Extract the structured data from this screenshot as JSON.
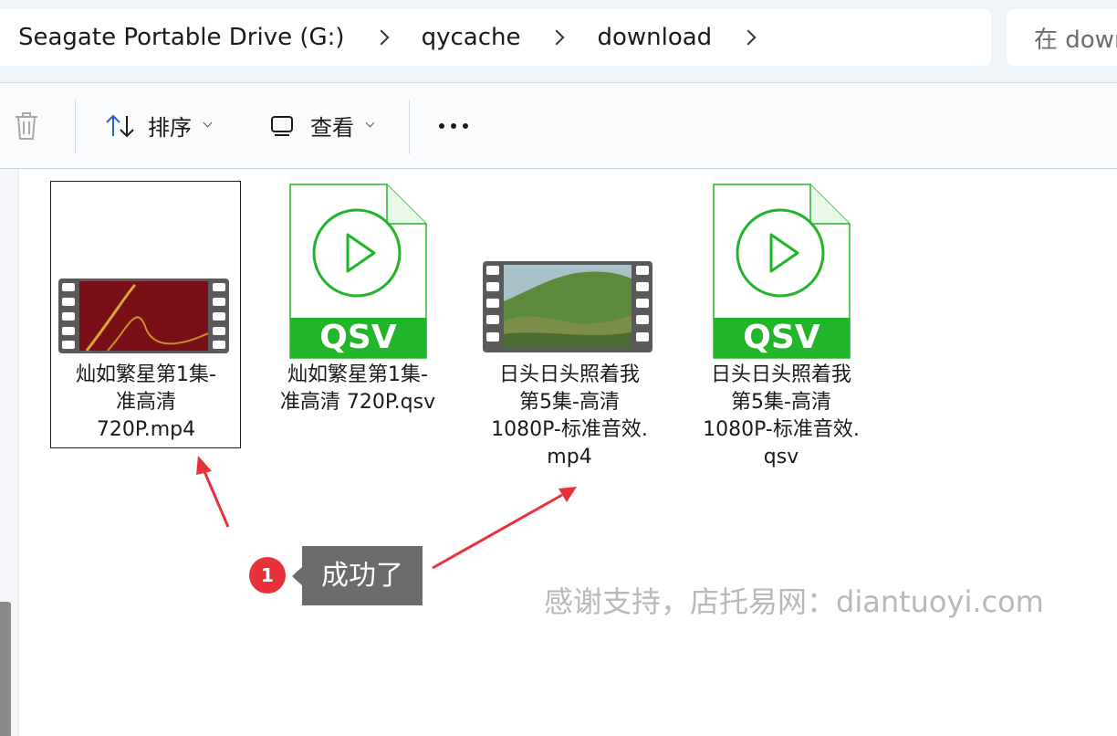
{
  "breadcrumb": {
    "items": [
      "Seagate Portable Drive (G:)",
      "qycache",
      "download"
    ]
  },
  "search": {
    "placeholder": "在 download"
  },
  "toolbar": {
    "sort_label": "排序",
    "view_label": "查看"
  },
  "files": [
    {
      "name_lines": [
        "灿如繁星第1集-",
        "准高清",
        "720P.mp4"
      ],
      "kind": "video-thumbnail",
      "selected": true
    },
    {
      "name_lines": [
        "灿如繁星第1集-",
        "准高清 720P.qsv"
      ],
      "kind": "qsv-file-icon",
      "badge": "QSV"
    },
    {
      "name_lines": [
        "日头日头照着我",
        "第5集-高清",
        "1080P-标准音效.",
        "mp4"
      ],
      "kind": "video-thumbnail"
    },
    {
      "name_lines": [
        "日头日头照着我",
        "第5集-高清",
        "1080P-标准音效.",
        "qsv"
      ],
      "kind": "qsv-file-icon",
      "badge": "QSV"
    }
  ],
  "annotation": {
    "step_number": "1",
    "tooltip": "成功了",
    "arrow_color": "#e8323a"
  },
  "watermark": "感谢支持，店托易网：diantuoyi.com",
  "colors": {
    "qsv_green": "#22b52a",
    "badge_red": "#e8323a",
    "tooltip_gray": "#6b6b6b"
  }
}
